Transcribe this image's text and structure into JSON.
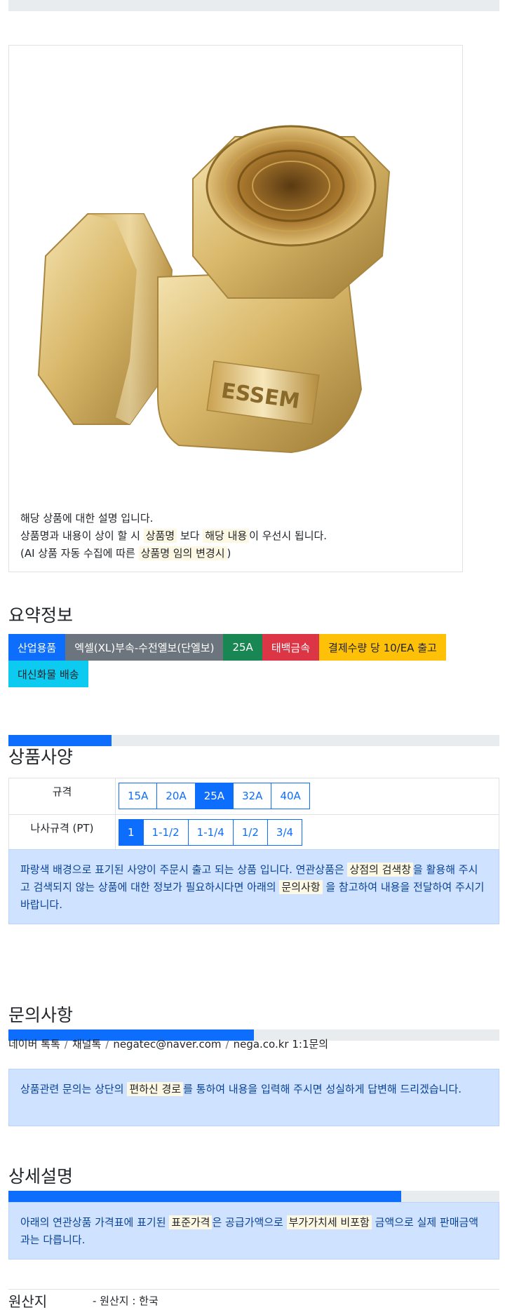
{
  "product": {
    "image_alt": "brass elbow fitting",
    "desc_line1": "해당 상품에 대한 설명 입니다.",
    "desc_line2_pre": "상품명과 내용이 상이 할 시 ",
    "desc_line2_mark1": "상품명",
    "desc_line2_mid": " 보다 ",
    "desc_line2_mark2": "해당 내용",
    "desc_line2_post": "이 우선시 됩니다.",
    "desc_line3_pre": "(AI 상품 자동 수집에 따른 ",
    "desc_line3_mark": "상품명 임의 변경시",
    "desc_line3_post": ")"
  },
  "summary": {
    "title": "요약정보",
    "badges": [
      "산업용품",
      "엑셀(XL)부속-수전엘보(단엘보)",
      "25A",
      "태백금속",
      "결제수량 당 10/EA 출고",
      "대신화물 배송"
    ]
  },
  "spec": {
    "progress": 0.21,
    "title": "상품사양",
    "rows": [
      {
        "label": "규격",
        "options": [
          "15A",
          "20A",
          "25A",
          "32A",
          "40A"
        ],
        "selected": "25A"
      },
      {
        "label": "나사규격 (PT)",
        "options": [
          "1",
          "1-1/2",
          "1-1/4",
          "1/2",
          "3/4"
        ],
        "selected": "1"
      }
    ],
    "notice_pre": "파랑색 배경으로 표기된 사양이 주문시 출고 되는 상품 입니다. 연관상품은 ",
    "notice_mark1": "상점의 검색창",
    "notice_mid": "을 활용해 주시고 검색되지 않는 상품에 대한 정보가 필요하시다면 아래의 ",
    "notice_mark2": "문의사항",
    "notice_post": " 을 참고하여 내용을 전달하여 주시기 바랍니다."
  },
  "inquiry": {
    "title": "문의사항",
    "progress": 0.5,
    "links": [
      "네이버 톡톡",
      "채널톡",
      "negatec@naver.com",
      "nega.co.kr 1:1문의"
    ],
    "notice_pre": "상품관련 문의는 상단의 ",
    "notice_mark": "편하신 경로",
    "notice_post": "를 통하여 내용을 입력해 주시면 성실하게 답변해 드리겠습니다."
  },
  "detail": {
    "title": "상세설명",
    "progress": 0.8,
    "notice_pre": "아래의 연관상품 가격표에 표기된 ",
    "notice_mark1": "표준가격",
    "notice_mid": "은 공급가액으로 ",
    "notice_mark2": "부가가치세 비포함",
    "notice_post": " 금액으로 실제 판매금액과는 다릅니다."
  },
  "origin": {
    "label": "원산지",
    "value": "- 원산지 : 한국"
  },
  "colors": {
    "primary": "#0d6efd",
    "secondary": "#6c757d",
    "success": "#198754",
    "danger": "#dc3545",
    "warning": "#ffc107",
    "info": "#0dcaf0",
    "alert_bg": "#cfe2ff"
  }
}
